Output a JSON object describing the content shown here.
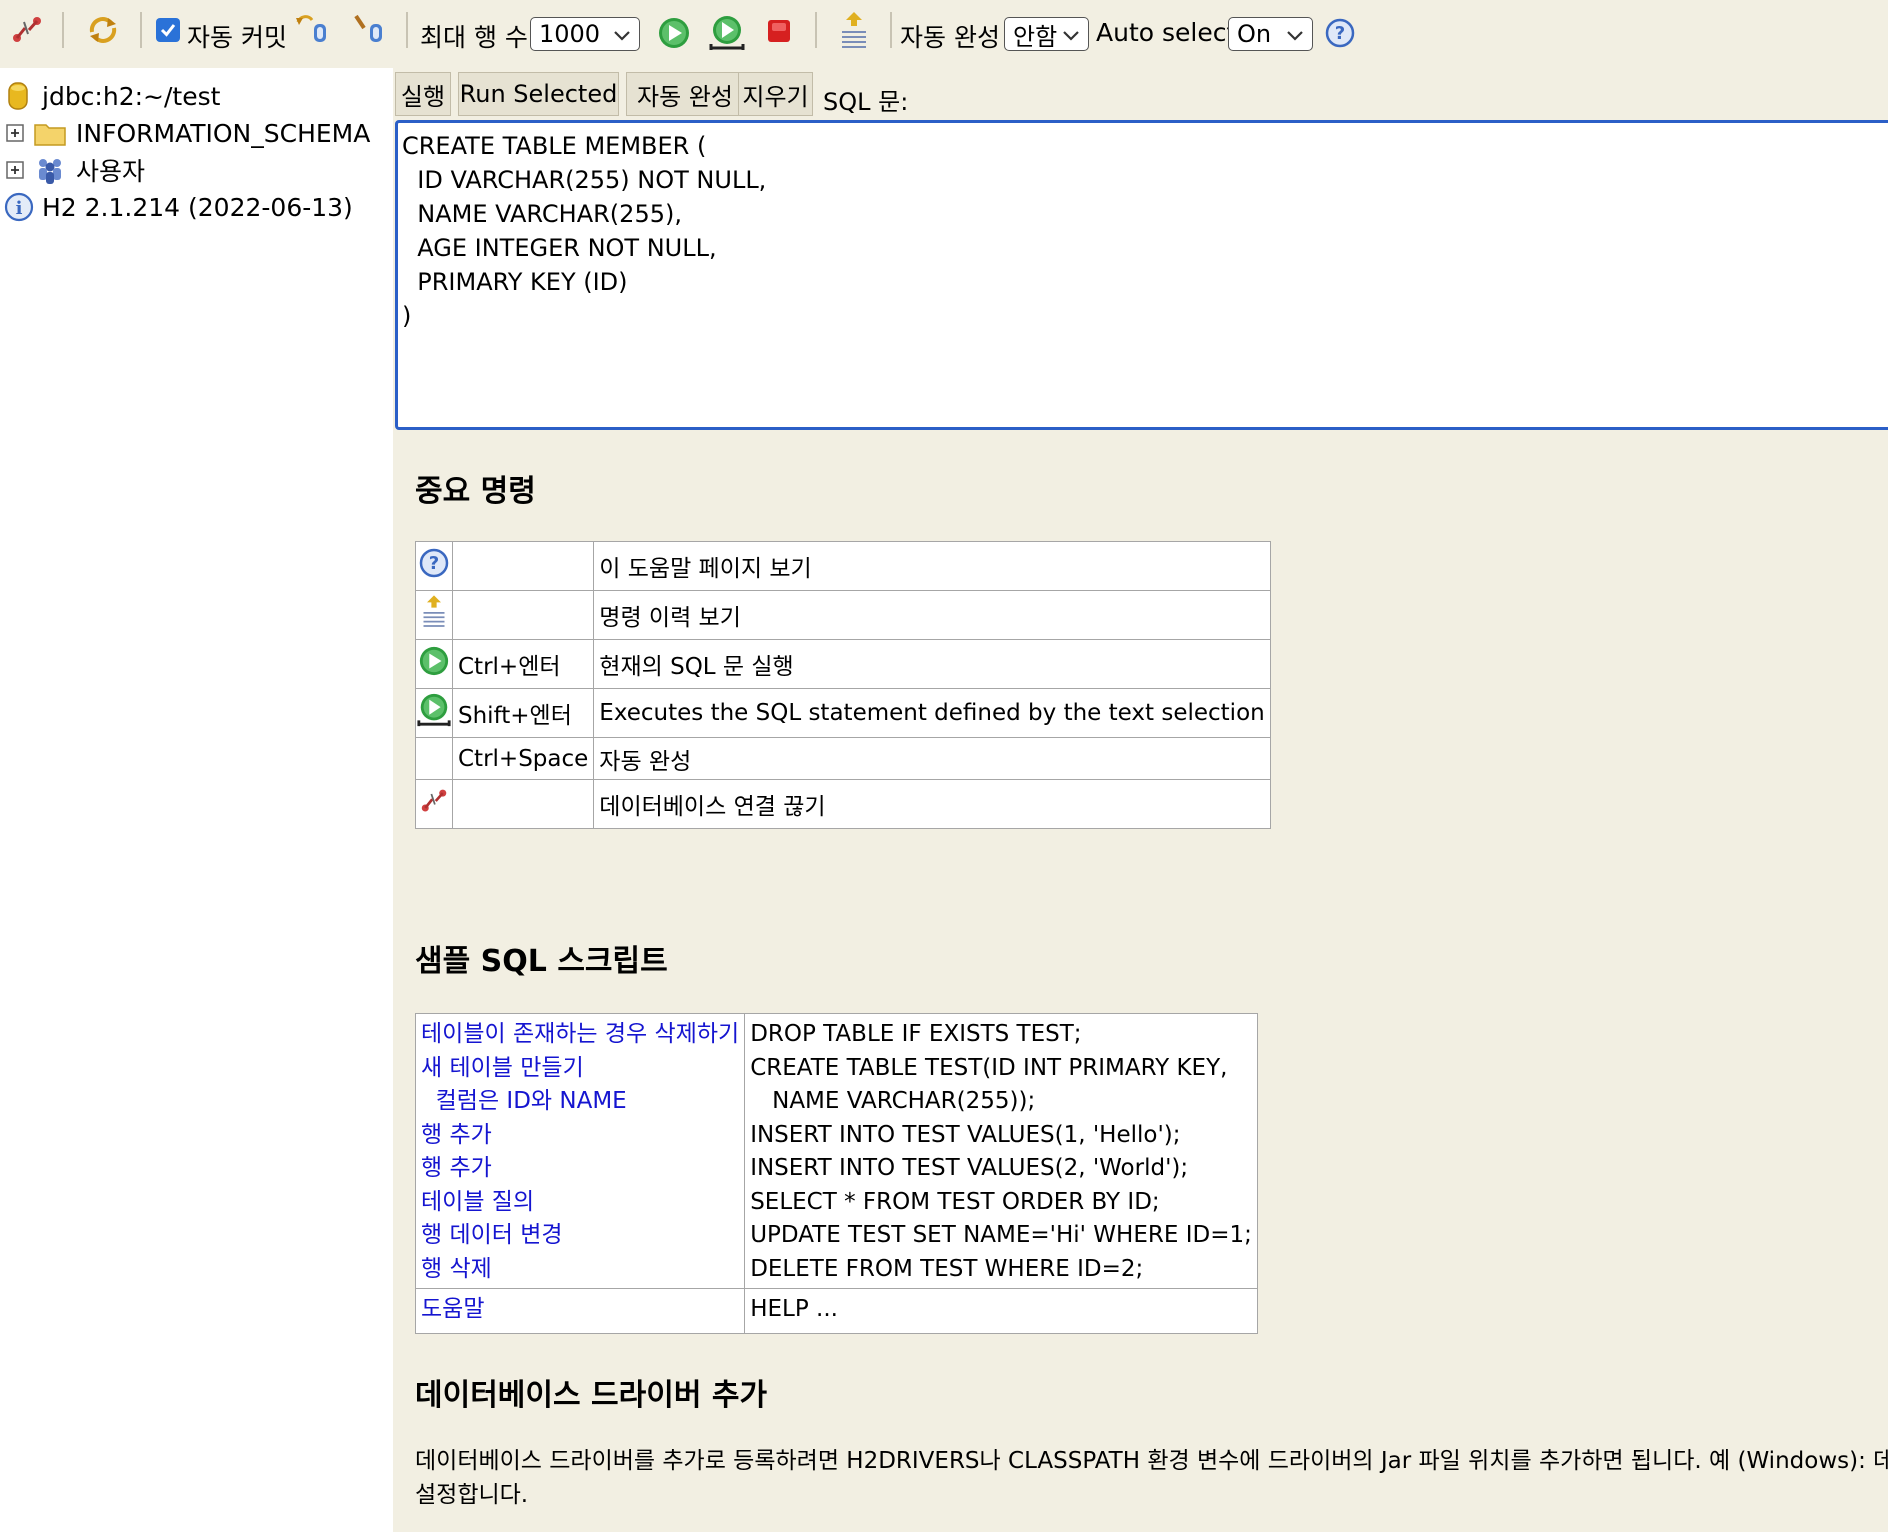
{
  "toolbar": {
    "auto_commit_label": "자동 커밋",
    "max_rows_label": "최대 행 수:",
    "max_rows_value": "1000",
    "autocomplete_label": "자동 완성",
    "autocomplete_value": "안함",
    "auto_select_label": "Auto select",
    "auto_select_value": "On",
    "auto_commit_checked": true
  },
  "tree": {
    "connection": "jdbc:h2:~/test",
    "schema": "INFORMATION_SCHEMA",
    "users": "사용자",
    "version": "H2 2.1.214 (2022-06-13)"
  },
  "main": {
    "buttons": [
      "실행",
      "Run Selected",
      "자동 완성",
      "지우기"
    ],
    "sql_label": "SQL 문:",
    "sql_text": "CREATE TABLE MEMBER (\n  ID VARCHAR(255) NOT NULL,\n  NAME VARCHAR(255),\n  AGE INTEGER NOT NULL,\n  PRIMARY KEY (ID)\n)"
  },
  "important": {
    "heading": "중요 명령",
    "rows": [
      {
        "icon": "help-icon",
        "key": "",
        "desc": "이 도움말 페이지 보기"
      },
      {
        "icon": "history-icon",
        "key": "",
        "desc": "명령 이력 보기"
      },
      {
        "icon": "run-icon",
        "key": "Ctrl+엔터",
        "desc": "현재의 SQL 문 실행"
      },
      {
        "icon": "run-selected-icon",
        "key": "Shift+엔터",
        "desc": "Executes the SQL statement defined by the text selection"
      },
      {
        "icon": "",
        "key": "Ctrl+Space",
        "desc": "자동 완성"
      },
      {
        "icon": "disconnect-icon",
        "key": "",
        "desc": "데이터베이스 연결 끊기"
      }
    ]
  },
  "samples": {
    "heading": "샘플 SQL 스크립트",
    "rows": [
      {
        "label": "테이블이 존재하는 경우 삭제하기",
        "sql": "DROP TABLE IF EXISTS TEST;"
      },
      {
        "label": "새 테이블 만들기",
        "sql": "CREATE TABLE TEST(ID INT PRIMARY KEY,"
      },
      {
        "label": "  컬럼은 ID와 NAME",
        "sql": "   NAME VARCHAR(255));"
      },
      {
        "label": "행 추가",
        "sql": "INSERT INTO TEST VALUES(1, 'Hello');"
      },
      {
        "label": "행 추가",
        "sql": "INSERT INTO TEST VALUES(2, 'World');"
      },
      {
        "label": "테이블 질의",
        "sql": "SELECT * FROM TEST ORDER BY ID;"
      },
      {
        "label": "행 데이터 변경",
        "sql": "UPDATE TEST SET NAME='Hi' WHERE ID=1;"
      },
      {
        "label": "행 삭제",
        "sql": "DELETE FROM TEST WHERE ID=2;"
      }
    ],
    "help_label": "도움말",
    "help_sql": "HELP ..."
  },
  "drivers": {
    "heading": "데이터베이스 드라이버 추가",
    "line1": "데이터베이스 드라이버를 추가로 등록하려면 H2DRIVERS나 CLASSPATH 환경 변수에 드라이버의 Jar 파일 위치를 추가하면 됩니다. 예 (Windows): 데이",
    "line2": "설정합니다."
  },
  "colors": {
    "background": "#f2efe2",
    "link": "#1515d0",
    "editor_border": "#2b5fc7",
    "run_green": "#2e9e3f",
    "stop_red": "#d62020"
  }
}
